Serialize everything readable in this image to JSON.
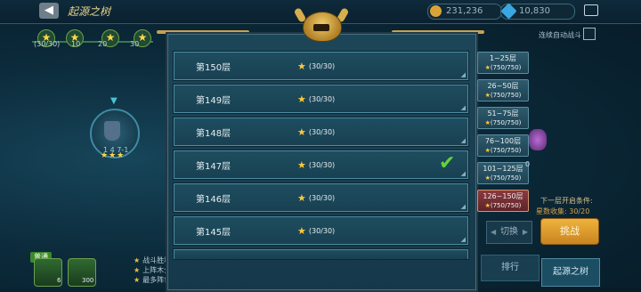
{
  "header": {
    "title": "起源之树",
    "gold": "231,236",
    "gems": "10,830"
  },
  "progress_bar": {
    "first_label": "(30/30)",
    "milestones": [
      "10",
      "20",
      "30"
    ]
  },
  "map_node": {
    "label": "1 4 7-1",
    "stars": "★★★"
  },
  "team": {
    "tag": "普通",
    "unit_counts": [
      "6",
      "300"
    ]
  },
  "conditions": [
    "战斗胜利",
    "上阵木士师兵数量 >6",
    "最多阵亡2人"
  ],
  "floors": [
    {
      "name": "第150层",
      "stars": "(30/30)"
    },
    {
      "name": "第149层",
      "stars": "(30/30)"
    },
    {
      "name": "第148层",
      "stars": "(30/30)"
    },
    {
      "name": "第147层",
      "stars": "(30/30)",
      "checked": true
    },
    {
      "name": "第146层",
      "stars": "(30/30)"
    },
    {
      "name": "第145层",
      "stars": "(30/30)"
    }
  ],
  "auto_battle_label": "连续自动战斗",
  "ranges": [
    {
      "label": "1~25层",
      "count": "(750/750)"
    },
    {
      "label": "26~50层",
      "count": "(750/750)"
    },
    {
      "label": "51~75层",
      "count": "(750/750)"
    },
    {
      "label": "76~100层",
      "count": "(750/750)"
    },
    {
      "label": "101~125层",
      "count": "(750/750)"
    },
    {
      "label": "126~150层",
      "count": "(750/750)",
      "active": true
    }
  ],
  "next_unlock": {
    "title": "下一层开启条件:",
    "value": "星数收集: 30/20"
  },
  "buttons": {
    "switch": "切换",
    "challenge": "挑战",
    "rank": "排行",
    "origin": "起源之树"
  },
  "side_monster_num": "0",
  "colors": {
    "accent": "#efb33d",
    "panel": "#1c4658",
    "active_range": "#8a3a3e",
    "check": "#64d43a"
  }
}
